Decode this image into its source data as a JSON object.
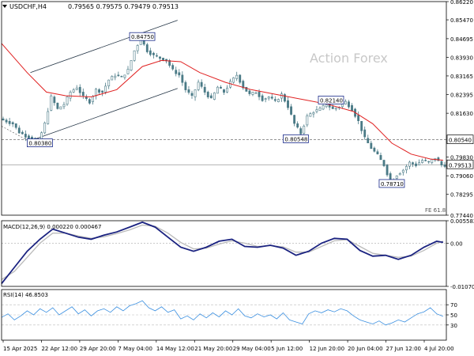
{
  "header": {
    "symbol_tf": "USDCHF,H4",
    "ohlc": "0.79565 0.79575 0.79479 0.79513",
    "watermark": "Action Forex"
  },
  "colors": {
    "candle": "#4a7a86",
    "ma": "#e02020",
    "channel": "#223344",
    "macd_main": "#1a2280",
    "macd_signal": "#bbbbbb",
    "rsi": "#3a8fe0",
    "grid": "#dddddd",
    "label_border": "#1a2a8a",
    "price_tag_fill": "#ffffff"
  },
  "chart_data": [
    {
      "type": "candlestick",
      "panel": "price",
      "y_ticks": [
        "0.86220",
        "0.85470",
        "0.84695",
        "0.83930",
        "0.83165",
        "0.82395",
        "0.81630",
        "0.80540",
        "0.79830",
        "0.79513",
        "0.79060",
        "0.78295",
        "0.77440"
      ],
      "ylim": [
        0.7744,
        0.8622
      ],
      "x_tick_labels": [
        "15 Apr 2025",
        "22 Apr 12:00",
        "29 Apr 20:00",
        "7 May 04:00",
        "14 May 12:00",
        "21 May 20:00",
        "29 May 04:00",
        "5 Jun 12:00",
        "12 Jun 20:00",
        "20 Jun 04:00",
        "27 Jun 12:00",
        "4 Jul 20:00"
      ],
      "price_path": [
        [
          0,
          0.814
        ],
        [
          4,
          0.812
        ],
        [
          6,
          0.8085
        ],
        [
          8,
          0.807
        ],
        [
          10,
          0.806
        ],
        [
          12,
          0.8045
        ],
        [
          14,
          0.812
        ],
        [
          16,
          0.823
        ],
        [
          18,
          0.818
        ],
        [
          20,
          0.82
        ],
        [
          22,
          0.825
        ],
        [
          24,
          0.827
        ],
        [
          26,
          0.823
        ],
        [
          28,
          0.821
        ],
        [
          30,
          0.826
        ],
        [
          32,
          0.825
        ],
        [
          34,
          0.83
        ],
        [
          36,
          0.832
        ],
        [
          38,
          0.831
        ],
        [
          40,
          0.834
        ],
        [
          42,
          0.842
        ],
        [
          44,
          0.847
        ],
        [
          46,
          0.842
        ],
        [
          48,
          0.84
        ],
        [
          50,
          0.839
        ],
        [
          52,
          0.838
        ],
        [
          54,
          0.834
        ],
        [
          56,
          0.832
        ],
        [
          58,
          0.826
        ],
        [
          60,
          0.823
        ],
        [
          62,
          0.829
        ],
        [
          64,
          0.825
        ],
        [
          66,
          0.822
        ],
        [
          68,
          0.827
        ],
        [
          70,
          0.825
        ],
        [
          72,
          0.829
        ],
        [
          74,
          0.832
        ],
        [
          76,
          0.827
        ],
        [
          78,
          0.824
        ],
        [
          80,
          0.825
        ],
        [
          82,
          0.822
        ],
        [
          84,
          0.823
        ],
        [
          86,
          0.821
        ],
        [
          88,
          0.824
        ],
        [
          90,
          0.819
        ],
        [
          92,
          0.812
        ],
        [
          94,
          0.808
        ],
        [
          96,
          0.815
        ],
        [
          98,
          0.817
        ],
        [
          100,
          0.818
        ],
        [
          102,
          0.82
        ],
        [
          104,
          0.818
        ],
        [
          106,
          0.819
        ],
        [
          108,
          0.821
        ],
        [
          110,
          0.818
        ],
        [
          112,
          0.813
        ],
        [
          114,
          0.806
        ],
        [
          116,
          0.802
        ],
        [
          118,
          0.799
        ],
        [
          120,
          0.795
        ],
        [
          122,
          0.788
        ],
        [
          124,
          0.791
        ],
        [
          126,
          0.793
        ],
        [
          128,
          0.796
        ],
        [
          130,
          0.795
        ],
        [
          132,
          0.797
        ],
        [
          134,
          0.796
        ],
        [
          136,
          0.798
        ],
        [
          138,
          0.795
        ]
      ],
      "ma_path": [
        [
          0,
          0.845
        ],
        [
          8,
          0.833
        ],
        [
          14,
          0.825
        ],
        [
          20,
          0.8235
        ],
        [
          28,
          0.823
        ],
        [
          36,
          0.826
        ],
        [
          44,
          0.8355
        ],
        [
          50,
          0.838
        ],
        [
          56,
          0.8375
        ],
        [
          62,
          0.833
        ],
        [
          70,
          0.829
        ],
        [
          78,
          0.826
        ],
        [
          86,
          0.824
        ],
        [
          94,
          0.822
        ],
        [
          102,
          0.82
        ],
        [
          110,
          0.817
        ],
        [
          116,
          0.812
        ],
        [
          122,
          0.804
        ],
        [
          128,
          0.7995
        ],
        [
          134,
          0.7975
        ],
        [
          138,
          0.797
        ]
      ],
      "channel_upper": [
        [
          9,
          0.833
        ],
        [
          55,
          0.8545
        ]
      ],
      "channel_lower": [
        [
          9,
          0.805
        ],
        [
          55,
          0.8265
        ]
      ],
      "horizontal_lines": [
        {
          "value": 0.8054,
          "label": "0.80540",
          "style": "dashed"
        },
        {
          "value": 0.79513,
          "label": "0.79513",
          "style": "solid"
        }
      ],
      "annotations": [
        {
          "text": "0.84750",
          "x": 40,
          "y": 0.8475
        },
        {
          "text": "0.80380",
          "x": 8,
          "y": 0.8038
        },
        {
          "text": "0.82140",
          "x": 99,
          "y": 0.8214
        },
        {
          "text": "0.80548",
          "x": 88,
          "y": 0.80548
        },
        {
          "text": "0.78710",
          "x": 118,
          "y": 0.7871
        }
      ],
      "corner_label": "FE 61.8"
    },
    {
      "type": "line",
      "panel": "macd",
      "title": "MACD(12,26,9) 0.000220 0.000467",
      "y_ticks": [
        "0.005582",
        "0.00",
        "-0.010703"
      ],
      "ylim": [
        -0.010703,
        0.005582
      ],
      "main": [
        [
          0,
          -0.01
        ],
        [
          4,
          -0.006
        ],
        [
          8,
          -0.002
        ],
        [
          10,
          -0.0005
        ],
        [
          12,
          0.001
        ],
        [
          16,
          0.0035
        ],
        [
          20,
          0.0025
        ],
        [
          24,
          0.0015
        ],
        [
          28,
          0.001
        ],
        [
          32,
          0.002
        ],
        [
          36,
          0.0028
        ],
        [
          40,
          0.004
        ],
        [
          44,
          0.0052
        ],
        [
          48,
          0.004
        ],
        [
          52,
          0.0015
        ],
        [
          56,
          -0.001
        ],
        [
          60,
          -0.002
        ],
        [
          64,
          -0.001
        ],
        [
          68,
          0.0005
        ],
        [
          72,
          0.001
        ],
        [
          76,
          -0.0008
        ],
        [
          80,
          -0.001
        ],
        [
          84,
          -0.0005
        ],
        [
          88,
          -0.0012
        ],
        [
          92,
          -0.003
        ],
        [
          96,
          -0.002
        ],
        [
          100,
          0.0
        ],
        [
          104,
          0.0012
        ],
        [
          108,
          0.001
        ],
        [
          112,
          -0.0018
        ],
        [
          116,
          -0.0032
        ],
        [
          120,
          -0.003
        ],
        [
          124,
          -0.004
        ],
        [
          128,
          -0.003
        ],
        [
          132,
          -0.001
        ],
        [
          136,
          0.0005
        ],
        [
          138,
          0.0002
        ]
      ],
      "signal": [
        [
          0,
          -0.009
        ],
        [
          4,
          -0.007
        ],
        [
          8,
          -0.0035
        ],
        [
          12,
          0.0
        ],
        [
          16,
          0.0025
        ],
        [
          20,
          0.0025
        ],
        [
          24,
          0.0018
        ],
        [
          28,
          0.0012
        ],
        [
          32,
          0.0016
        ],
        [
          36,
          0.0024
        ],
        [
          40,
          0.0033
        ],
        [
          44,
          0.0045
        ],
        [
          48,
          0.0042
        ],
        [
          52,
          0.0025
        ],
        [
          56,
          0.0002
        ],
        [
          60,
          -0.0014
        ],
        [
          64,
          -0.0012
        ],
        [
          68,
          -0.0002
        ],
        [
          72,
          0.0006
        ],
        [
          76,
          0.0
        ],
        [
          80,
          -0.0008
        ],
        [
          84,
          -0.0006
        ],
        [
          88,
          -0.0009
        ],
        [
          92,
          -0.0022
        ],
        [
          96,
          -0.0022
        ],
        [
          100,
          -0.0008
        ],
        [
          104,
          0.0006
        ],
        [
          108,
          0.0009
        ],
        [
          112,
          -0.0008
        ],
        [
          116,
          -0.0025
        ],
        [
          120,
          -0.003
        ],
        [
          124,
          -0.0035
        ],
        [
          128,
          -0.0032
        ],
        [
          132,
          -0.0018
        ],
        [
          136,
          0.0
        ],
        [
          138,
          0.0005
        ]
      ]
    },
    {
      "type": "line",
      "panel": "rsi",
      "title": "RSI(14) 46.8503",
      "y_ticks": [
        "70",
        "50",
        "30"
      ],
      "ylim": [
        0,
        100
      ],
      "values": [
        [
          0,
          45
        ],
        [
          2,
          52
        ],
        [
          4,
          40
        ],
        [
          6,
          48
        ],
        [
          8,
          58
        ],
        [
          10,
          50
        ],
        [
          12,
          62
        ],
        [
          14,
          55
        ],
        [
          16,
          64
        ],
        [
          18,
          50
        ],
        [
          20,
          58
        ],
        [
          22,
          66
        ],
        [
          24,
          52
        ],
        [
          26,
          60
        ],
        [
          28,
          48
        ],
        [
          30,
          58
        ],
        [
          32,
          62
        ],
        [
          34,
          55
        ],
        [
          36,
          66
        ],
        [
          38,
          58
        ],
        [
          40,
          68
        ],
        [
          42,
          72
        ],
        [
          44,
          78
        ],
        [
          46,
          64
        ],
        [
          48,
          58
        ],
        [
          50,
          66
        ],
        [
          52,
          55
        ],
        [
          54,
          60
        ],
        [
          56,
          42
        ],
        [
          58,
          48
        ],
        [
          60,
          40
        ],
        [
          62,
          52
        ],
        [
          64,
          44
        ],
        [
          66,
          54
        ],
        [
          68,
          46
        ],
        [
          70,
          58
        ],
        [
          72,
          50
        ],
        [
          74,
          62
        ],
        [
          76,
          48
        ],
        [
          78,
          44
        ],
        [
          80,
          52
        ],
        [
          82,
          46
        ],
        [
          84,
          50
        ],
        [
          86,
          42
        ],
        [
          88,
          54
        ],
        [
          90,
          40
        ],
        [
          92,
          36
        ],
        [
          94,
          32
        ],
        [
          96,
          52
        ],
        [
          98,
          58
        ],
        [
          100,
          54
        ],
        [
          102,
          60
        ],
        [
          104,
          56
        ],
        [
          106,
          62
        ],
        [
          108,
          58
        ],
        [
          110,
          48
        ],
        [
          112,
          40
        ],
        [
          114,
          36
        ],
        [
          116,
          32
        ],
        [
          118,
          38
        ],
        [
          120,
          30
        ],
        [
          122,
          34
        ],
        [
          124,
          40
        ],
        [
          126,
          36
        ],
        [
          128,
          44
        ],
        [
          130,
          52
        ],
        [
          132,
          56
        ],
        [
          134,
          64
        ],
        [
          136,
          52
        ],
        [
          138,
          47
        ]
      ]
    }
  ]
}
